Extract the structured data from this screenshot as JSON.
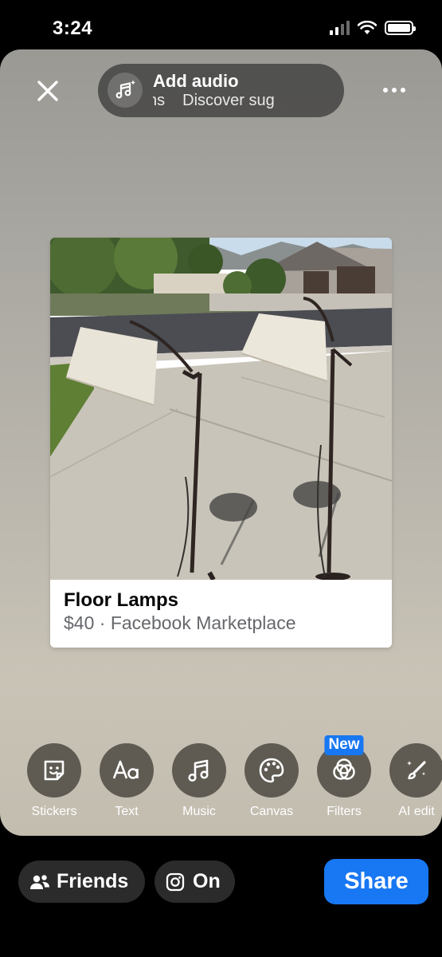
{
  "status_bar": {
    "time": "3:24",
    "icons": [
      "cellular-signal-icon",
      "wifi-icon",
      "battery-icon"
    ]
  },
  "top_bar": {
    "close_icon": "close-icon",
    "more_icon": "more-options-icon",
    "audio": {
      "icon": "music-note-sparkle-icon",
      "title": "Add audio",
      "subtitle_prev": "ns",
      "subtitle": "Discover sug"
    }
  },
  "post": {
    "title": "Floor Lamps",
    "subtitle": "$40 · Facebook Marketplace"
  },
  "tools": [
    {
      "label": "Stickers",
      "icon": "sticker-icon"
    },
    {
      "label": "Text",
      "icon": "text-aa-icon"
    },
    {
      "label": "Music",
      "icon": "music-note-icon"
    },
    {
      "label": "Canvas",
      "icon": "palette-icon"
    },
    {
      "label": "Filters",
      "icon": "filters-icon",
      "badge": "New"
    },
    {
      "label": "AI edit",
      "icon": "ai-edit-brush-icon"
    }
  ],
  "bottom_bar": {
    "friends_label": "Friends",
    "on_label": "On",
    "share_label": "Share"
  },
  "colors": {
    "accent": "#1877f2",
    "pill_bg": "#2b2b2b"
  }
}
